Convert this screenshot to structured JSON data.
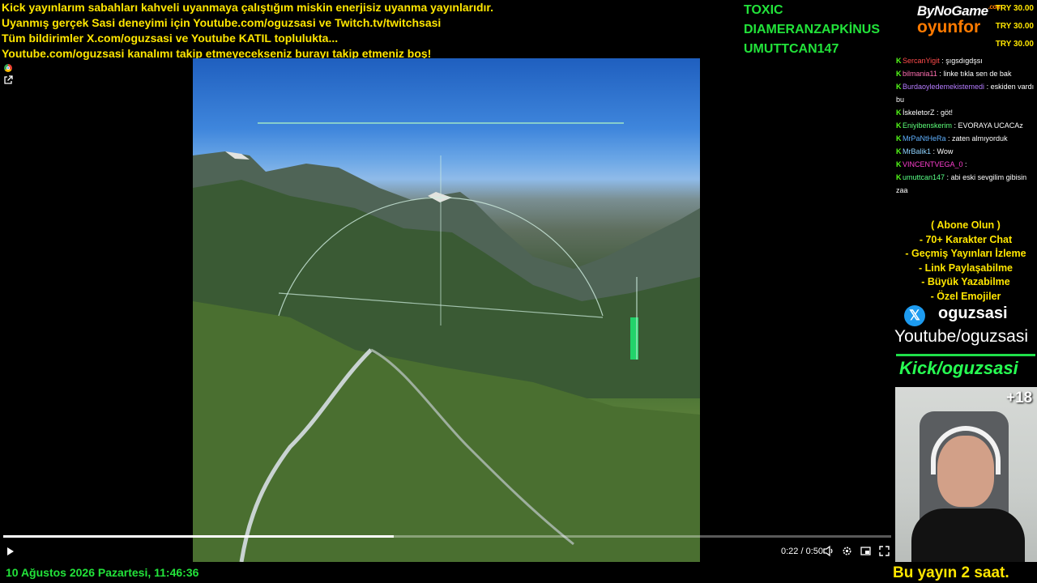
{
  "ticker": {
    "lines": [
      "Kick yayınlarım sabahları kahveli uyanmaya çalıştığım miskin enerjisiz uyanma yayınlarıdır.",
      "Uyanmış gerçek Sasi deneyimi için Youtube.com/oguzsasi ve Twitch.tv/twitchsasi",
      "Tüm bildirimler X.com/oguzsasi ve Youtube KATIL toplulukta...",
      "Youtube.com/oguzsasi kanalımı takip etmeyecekseniz burayı takip etmeniz boş!"
    ]
  },
  "donors": [
    "TOXIC",
    "DIAMERANZAPKİNUS",
    "UMUTTCAN147"
  ],
  "logo": {
    "top": "ByNoGame",
    "dotcom": ".com",
    "bottom": "oyunfor"
  },
  "donations": [
    "TRY 30.00",
    "TRY 30.00",
    "TRY 30.00"
  ],
  "chat": {
    "messages": [
      {
        "user": "SercanYigit",
        "color": "#ff4b4b",
        "text": "şıgsdıgdşsı"
      },
      {
        "user": "bilmania11",
        "color": "#ff6fb0",
        "text": "linke tıkla sen de bak"
      },
      {
        "user": "Burdaoyledemekistemedi",
        "color": "#b57cff",
        "text": "eskiden vardı bu"
      },
      {
        "user": "İskeletorZ",
        "color": "#ffffff",
        "text": "göt!"
      },
      {
        "user": "Eniyibenskerim",
        "color": "#5dff7a",
        "text": "EVORAYA UCACAz"
      },
      {
        "user": "MrPaNtHeRa",
        "color": "#5fb1ff",
        "text": "zaten almıyorduk"
      },
      {
        "user": "MrBalik1",
        "color": "#8fd3ff",
        "text": "Wow"
      },
      {
        "user": "VINCENTVEGA_0",
        "color": "#ff3fd0",
        "text": ""
      },
      {
        "user": "umuttcan147",
        "color": "#59ff86",
        "text": "abi eski sevgilim gibisin zaa"
      }
    ]
  },
  "subscribe": {
    "lines": [
      "( Abone Olun )",
      "- 70+ Karakter Chat",
      "- Geçmiş Yayınları İzleme",
      "- Link Paylaşabilme",
      "- Büyük Yazabilme",
      "- Özel Emojiler"
    ]
  },
  "social": {
    "x_glyph": "𝕏",
    "x_handle": "oguzsasi",
    "youtube": "Youtube/oguzsasi",
    "kick": "Kick/oguzsasi"
  },
  "webcam": {
    "age_badge": "+18"
  },
  "bottom_banner": "Bu yayın 2 saat.",
  "datetime": "10 Ağustos 2026 Pazartesi, 11:46:36",
  "player": {
    "time": "0:22 / 0:50",
    "progress": 0.44
  },
  "colors": {
    "ticker": "#ffe600",
    "donor": "#22e33a",
    "kick_green": "#53fc18",
    "logo_orange": "#ff7a00"
  }
}
